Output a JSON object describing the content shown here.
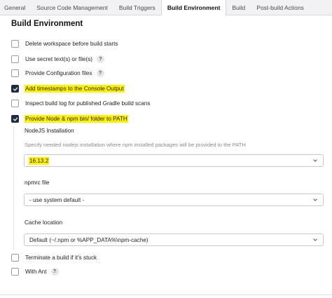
{
  "tabs": [
    {
      "label": "General",
      "active": false
    },
    {
      "label": "Source Code Management",
      "active": false
    },
    {
      "label": "Build Triggers",
      "active": false
    },
    {
      "label": "Build Environment",
      "active": true
    },
    {
      "label": "Build",
      "active": false
    },
    {
      "label": "Post-build Actions",
      "active": false
    }
  ],
  "section": {
    "title": "Build Environment"
  },
  "options": [
    {
      "label": "Delete workspace before build starts",
      "checked": false,
      "help": false
    },
    {
      "label": "Use secret text(s) or file(s)",
      "checked": false,
      "help": true
    },
    {
      "label": "Provide Configuration files",
      "checked": false,
      "help": true
    },
    {
      "label": "Add timestamps to the Console Output",
      "checked": true,
      "help": false,
      "highlighted": true
    },
    {
      "label": "Inspect build log for published Gradle build scans",
      "checked": false,
      "help": false
    },
    {
      "label": "Provide Node & npm bin/ folder to PATH",
      "checked": true,
      "help": false,
      "highlighted": true
    }
  ],
  "nodejs": {
    "installation_label": "NodeJS Installation",
    "installation_desc": "Specify needed nodejs installation where npm installed packages will be provided to the PATH",
    "installation_value": "16.13.2",
    "npmrc_label": "npmrc file",
    "npmrc_value": "- use system default -",
    "cache_label": "Cache location",
    "cache_value": "Default (~/.npm or %APP_DATA%\\npm-cache)"
  },
  "trailing_options": [
    {
      "label": "Terminate a build if it's stuck",
      "checked": false,
      "help": false
    },
    {
      "label": "With Ant",
      "checked": false,
      "help": true
    }
  ],
  "help_glyph": "?",
  "colors": {
    "highlight": "#fff200",
    "checkbox_checked": "#1f2a44"
  }
}
